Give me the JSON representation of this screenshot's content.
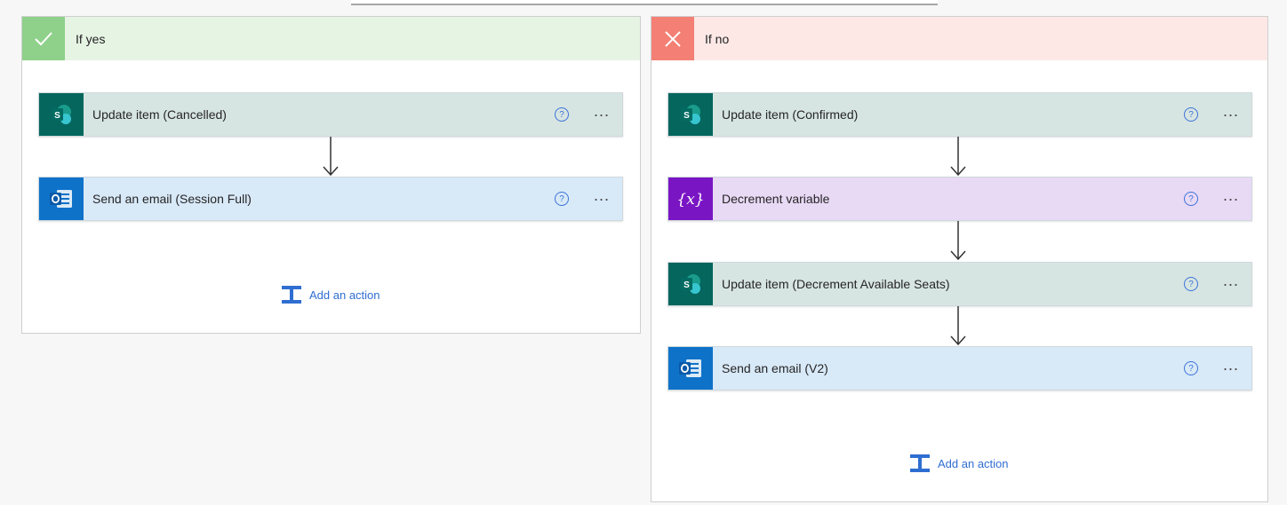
{
  "branches": {
    "yes": {
      "title": "If yes",
      "badge_icon": "checkmark-icon",
      "actions": [
        {
          "label": "Update item (Cancelled)",
          "icon": "sharepoint-icon"
        },
        {
          "label": "Send an email (Session Full)",
          "icon": "outlook-icon"
        }
      ],
      "add_action_label": "Add an action"
    },
    "no": {
      "title": "If no",
      "badge_icon": "close-icon",
      "actions": [
        {
          "label": "Update item (Confirmed)",
          "icon": "sharepoint-icon"
        },
        {
          "label": "Decrement variable",
          "icon": "variable-icon"
        },
        {
          "label": "Update item (Decrement Available Seats)",
          "icon": "sharepoint-icon"
        },
        {
          "label": "Send an email (V2)",
          "icon": "outlook-icon"
        }
      ],
      "add_action_label": "Add an action"
    }
  },
  "common": {
    "help_glyph": "?",
    "more_glyph": "..."
  },
  "colors": {
    "yes_header": "#e6f4e4",
    "yes_badge": "#8fd18b",
    "no_header": "#fde8e6",
    "no_badge": "#f47f74",
    "sharepoint": "#05665e",
    "outlook": "#0f72c9",
    "variable": "#7a15c4",
    "link": "#2f6ed1"
  }
}
